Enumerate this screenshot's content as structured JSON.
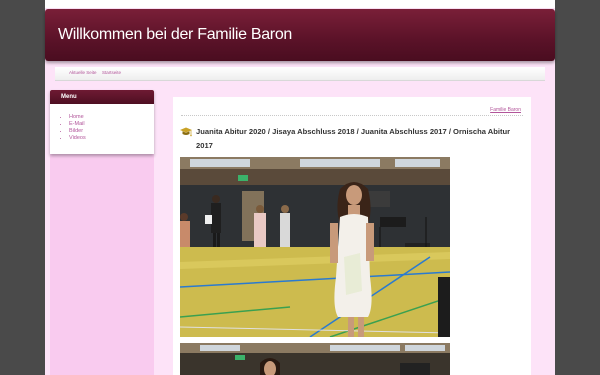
{
  "site": {
    "title": "Willkommen bei der Familie Baron"
  },
  "nav": {
    "items": [
      {
        "label": "Aktuelle Seite"
      },
      {
        "label": "Startseite"
      }
    ]
  },
  "sidebar": {
    "heading": "Menu",
    "items": [
      {
        "label": "Home"
      },
      {
        "label": "E-Mail"
      },
      {
        "label": "Bilder"
      },
      {
        "label": "Videos"
      }
    ]
  },
  "content": {
    "breadcrumb": "Familie Baron",
    "post_title": "Juanita Abitur 2020 / Jisaya Abschluss 2018 / Juanita Abschluss 2017 / Ornischa Abitur 2017",
    "icon": "graduation-icon"
  },
  "colors": {
    "background": "#4a4a4a",
    "page": "#fde3f8",
    "banner": "#5a1228",
    "link": "#b2559a"
  }
}
